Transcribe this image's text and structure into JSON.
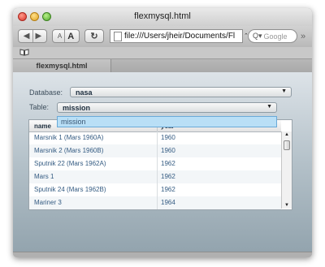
{
  "window": {
    "title": "flexmysql.html"
  },
  "toolbar": {
    "back_icon": "back-arrow-icon",
    "forward_icon": "forward-arrow-icon",
    "font_smaller": "A",
    "font_larger": "A",
    "reload_icon": "reload-icon",
    "url": "file:///Users/jheir/Documents/Fl",
    "search_placeholder": "Google",
    "overflow": "»"
  },
  "bookmarks": {
    "icon": "book-icon"
  },
  "tabs": [
    {
      "label": "flexmysql.html"
    }
  ],
  "form": {
    "database_label": "Database:",
    "database_value": "nasa",
    "table_label": "Table:",
    "table_value": "mission",
    "table_options": [
      "mission"
    ]
  },
  "grid": {
    "columns": [
      "name",
      "year"
    ],
    "rows": [
      {
        "name": "Marsnik 1 (Mars 1960A)",
        "year": "1960"
      },
      {
        "name": "Marsnik 2 (Mars 1960B)",
        "year": "1960"
      },
      {
        "name": "Sputnik 22 (Mars 1962A)",
        "year": "1962"
      },
      {
        "name": "Mars 1",
        "year": "1962"
      },
      {
        "name": "Sputnik 24 (Mars 1962B)",
        "year": "1962"
      },
      {
        "name": "Mariner 3",
        "year": "1964"
      }
    ]
  }
}
